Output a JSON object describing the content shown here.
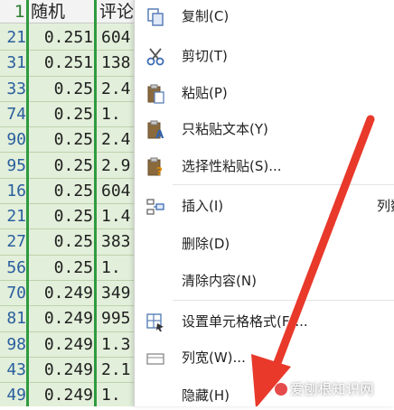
{
  "sheet": {
    "headers": {
      "col_a": "1",
      "col_b": "随机",
      "col_c": "评论"
    },
    "filter_icon": "filter-dropdown-icon",
    "rows": [
      {
        "a": "21",
        "b": "0.251",
        "c": "604"
      },
      {
        "a": "31",
        "b": "0.251",
        "c": "138"
      },
      {
        "a": "33",
        "b": "0.25",
        "c": "2.4"
      },
      {
        "a": "74",
        "b": "0.25",
        "c": "1."
      },
      {
        "a": "90",
        "b": "0.25",
        "c": "2.4"
      },
      {
        "a": "95",
        "b": "0.25",
        "c": "2.9"
      },
      {
        "a": "16",
        "b": "0.25",
        "c": "604"
      },
      {
        "a": "21",
        "b": "0.25",
        "c": "1.4"
      },
      {
        "a": "27",
        "b": "0.25",
        "c": "383"
      },
      {
        "a": "56",
        "b": "0.25",
        "c": "1."
      },
      {
        "a": "70",
        "b": "0.249",
        "c": "349"
      },
      {
        "a": "81",
        "b": "0.249",
        "c": "995"
      },
      {
        "a": "98",
        "b": "0.249",
        "c": "1.3"
      },
      {
        "a": "43",
        "b": "0.249",
        "c": "2.1"
      },
      {
        "a": "49",
        "b": "0.249",
        "c": "1."
      }
    ]
  },
  "menu": {
    "items": [
      {
        "label": "复制(C)",
        "icon": "copy-icon"
      },
      {
        "label": "剪切(T)",
        "icon": "scissors-icon"
      },
      {
        "label": "粘贴(P)",
        "icon": "paste-icon"
      },
      {
        "label": "只粘贴文本(Y)",
        "icon": "paste-text-icon"
      },
      {
        "label": "选择性粘贴(S)...",
        "icon": "paste-special-icon"
      },
      {
        "label": "插入(I)",
        "icon": "insert-icon",
        "extra": "列数"
      },
      {
        "label": "删除(D)",
        "icon": ""
      },
      {
        "label": "清除内容(N)",
        "icon": ""
      },
      {
        "label": "设置单元格格式(F)...",
        "icon": "format-cells-icon"
      },
      {
        "label": "列宽(W)...",
        "icon": "column-width-icon"
      },
      {
        "label": "隐藏(H)",
        "icon": ""
      }
    ]
  },
  "watermark": {
    "text": "爱刨根知识网"
  },
  "colors": {
    "selection_green": "#2f9a3f",
    "sheet_fill": "#e2efda",
    "arrow_red": "#e8392b"
  }
}
